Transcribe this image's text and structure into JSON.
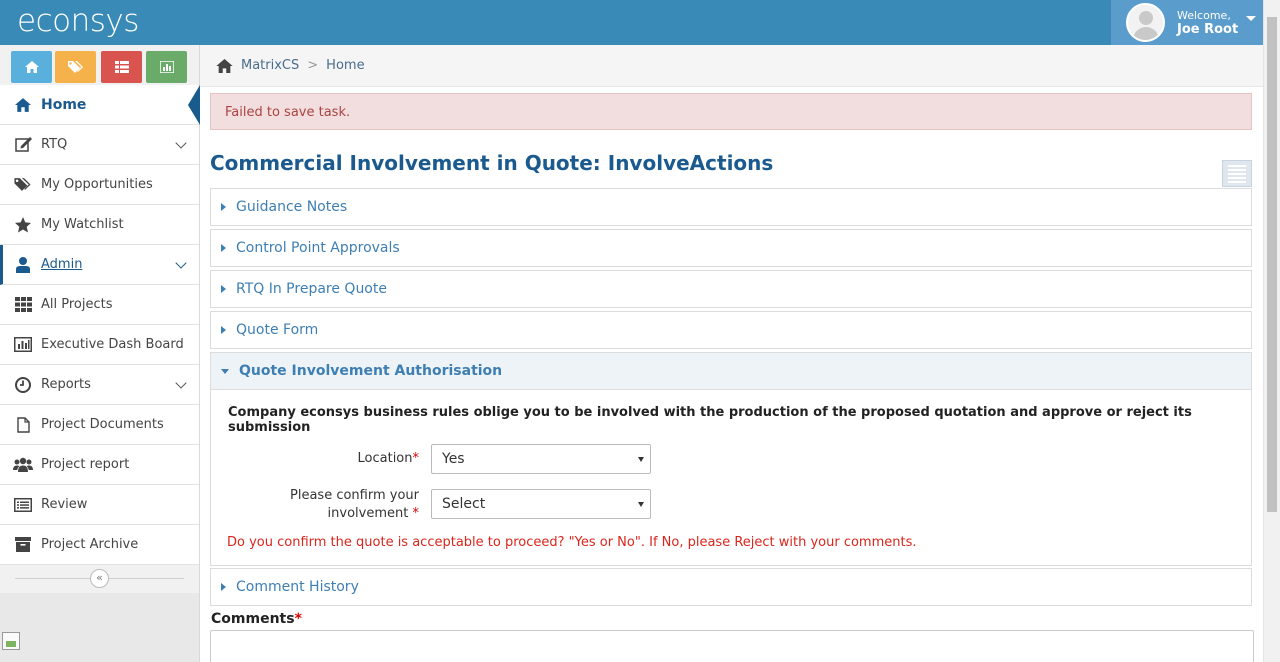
{
  "header": {
    "logo": "econsys",
    "welcome": "Welcome,",
    "user_name": "Joe Root"
  },
  "quick_buttons": [
    {
      "icon": "home-icon",
      "color": "#5ab0dd"
    },
    {
      "icon": "tags-icon",
      "color": "#f5b14a"
    },
    {
      "icon": "table-icon",
      "color": "#d9534f"
    },
    {
      "icon": "chart-icon",
      "color": "#6aab6a"
    }
  ],
  "sidebar": {
    "items": [
      {
        "label": "Home",
        "icon": "home-icon"
      },
      {
        "label": "RTQ",
        "icon": "edit-icon"
      },
      {
        "label": "My Opportunities",
        "icon": "tags-icon"
      },
      {
        "label": "My Watchlist",
        "icon": "star-icon"
      },
      {
        "label": "Admin",
        "icon": "user-icon"
      },
      {
        "label": "All Projects",
        "icon": "grid-icon"
      },
      {
        "label": "Executive Dash Board",
        "icon": "bar-chart-icon"
      },
      {
        "label": "Reports",
        "icon": "clock-icon"
      },
      {
        "label": "Project Documents",
        "icon": "file-icon"
      },
      {
        "label": "Project report",
        "icon": "users-icon"
      },
      {
        "label": "Review",
        "icon": "list-icon"
      },
      {
        "label": "Project Archive",
        "icon": "archive-icon"
      }
    ],
    "collapse_glyph": "«"
  },
  "breadcrumb": {
    "items": [
      "MatrixCS",
      "Home"
    ],
    "separator": ">"
  },
  "alert": "Failed to save task.",
  "page_title": "Commercial Involvement in Quote: InvolveActions",
  "panels": [
    "Guidance Notes",
    "Control Point Approvals",
    "RTQ In Prepare Quote",
    "Quote Form",
    "Quote Involvement Authorisation",
    "Comment History"
  ],
  "form": {
    "rules_text": "Company econsys business rules oblige you to be involved with the production of the proposed quotation and approve or reject its submission",
    "location_label": "Location",
    "location_value": "Yes",
    "confirm_label_1": "Please confirm your",
    "confirm_label_2": "involvement",
    "confirm_value": "Select",
    "required_mark": "*",
    "warning": "Do you confirm the quote is acceptable to proceed? \"Yes or No\". If No, please Reject with your comments.",
    "comments_label": "Comments"
  }
}
